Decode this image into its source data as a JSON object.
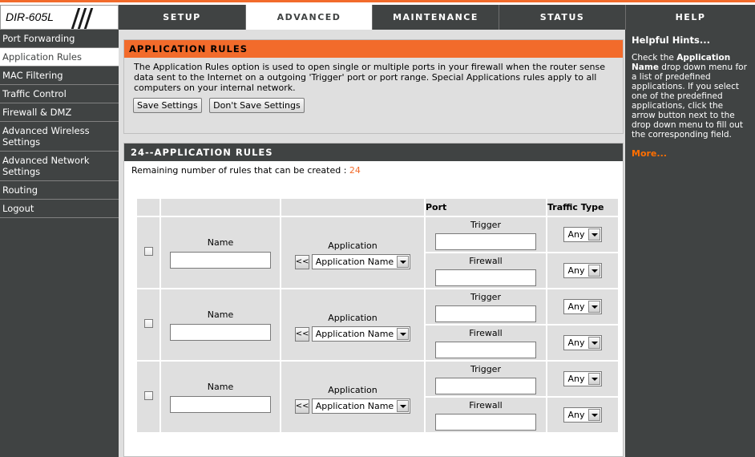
{
  "brand": {
    "model": "DIR-605L"
  },
  "nav": {
    "tabs": [
      {
        "label": "SETUP"
      },
      {
        "label": "ADVANCED"
      },
      {
        "label": "MAINTENANCE"
      },
      {
        "label": "STATUS"
      },
      {
        "label": "HELP"
      }
    ],
    "active": "ADVANCED"
  },
  "sidebar": {
    "items": [
      {
        "label": "Port Forwarding"
      },
      {
        "label": "Application Rules"
      },
      {
        "label": "MAC Filtering"
      },
      {
        "label": "Traffic Control"
      },
      {
        "label": "Firewall & DMZ"
      },
      {
        "label": "Advanced Wireless Settings"
      },
      {
        "label": "Advanced Network Settings"
      },
      {
        "label": "Routing"
      },
      {
        "label": "Logout"
      }
    ],
    "active": "Application Rules"
  },
  "intro": {
    "title": "APPLICATION RULES",
    "description": "The Application Rules option is used to open single or multiple ports in your firewall when the router sense data sent to the Internet on a outgoing 'Trigger' port or port range. Special Applications rules apply to all computers on your internal network.",
    "save_label": "Save Settings",
    "dont_save_label": "Don't Save Settings"
  },
  "rules": {
    "title": "24--APPLICATION RULES",
    "remaining_label": "Remaining number of rules that can be created :",
    "remaining_count": "24",
    "headers": {
      "port": "Port",
      "traffic_type": "Traffic Type"
    },
    "row_labels": {
      "name": "Name",
      "application": "Application",
      "trigger": "Trigger",
      "firewall": "Firewall",
      "copy_button": "<<"
    },
    "rows": [
      {
        "name_value": "",
        "application_select": "Application Name",
        "trigger_value": "",
        "firewall_value": "",
        "trigger_type": "Any",
        "firewall_type": "Any",
        "enabled": false
      },
      {
        "name_value": "",
        "application_select": "Application Name",
        "trigger_value": "",
        "firewall_value": "",
        "trigger_type": "Any",
        "firewall_type": "Any",
        "enabled": false
      },
      {
        "name_value": "",
        "application_select": "Application Name",
        "trigger_value": "",
        "firewall_value": "",
        "trigger_type": "Any",
        "firewall_type": "Any",
        "enabled": false
      }
    ]
  },
  "hints": {
    "title": "Helpful Hints...",
    "text_before": "Check the ",
    "text_bold": "Application Name",
    "text_after": " drop down menu for a list of predefined applications. If you select one of the predefined applications, click the arrow button next to the drop down menu to fill out the corresponding field.",
    "more": "More..."
  },
  "colors": {
    "accent": "#f26b2b",
    "dark": "#404343",
    "panel": "#dfdfdf"
  }
}
